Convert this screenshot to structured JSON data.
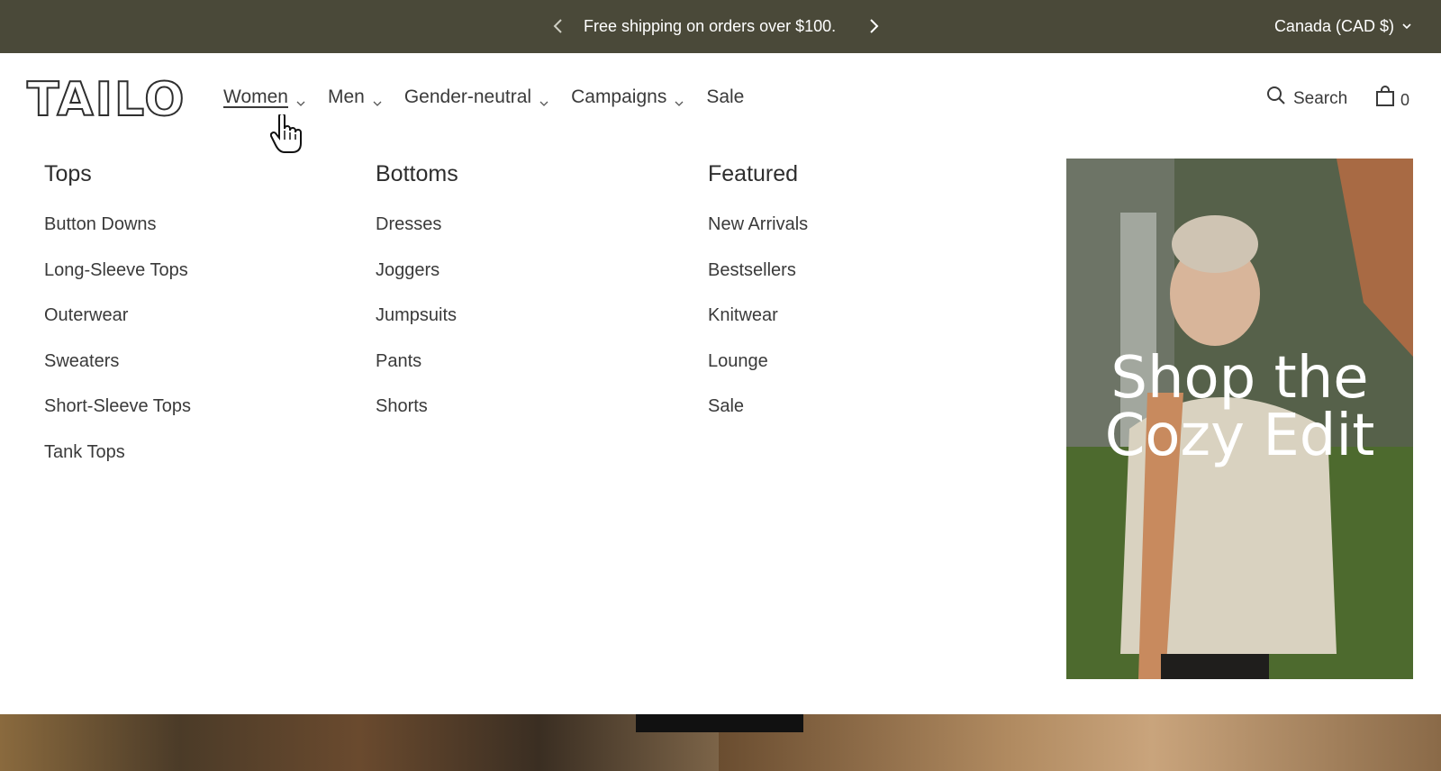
{
  "announcement": {
    "message": "Free shipping on orders over $100.",
    "prev_icon": "chevron-left-icon",
    "next_icon": "chevron-right-icon",
    "region": "Canada (CAD $)",
    "background_color": "#4a4939"
  },
  "header": {
    "logo_text": "TAILOR",
    "nav": [
      {
        "label": "Women",
        "has_dropdown": true,
        "active": true
      },
      {
        "label": "Men",
        "has_dropdown": true
      },
      {
        "label": "Gender-neutral",
        "has_dropdown": true
      },
      {
        "label": "Campaigns",
        "has_dropdown": true
      },
      {
        "label": "Sale",
        "has_dropdown": false
      }
    ],
    "search_label": "Search",
    "cart_count": "0"
  },
  "mega_menu": {
    "columns": [
      {
        "title": "Tops",
        "items": [
          "Button Downs",
          "Long-Sleeve Tops",
          "Outerwear",
          "Sweaters",
          "Short-Sleeve Tops",
          "Tank Tops"
        ]
      },
      {
        "title": "Bottoms",
        "items": [
          "Dresses",
          "Joggers",
          "Jumpsuits",
          "Pants",
          "Shorts"
        ]
      },
      {
        "title": "Featured",
        "items": [
          "New Arrivals",
          "Bestsellers",
          "Knitwear",
          "Lounge",
          "Sale"
        ]
      }
    ],
    "promo": {
      "line1": "Shop the",
      "line2": "Cozy Edit"
    }
  }
}
